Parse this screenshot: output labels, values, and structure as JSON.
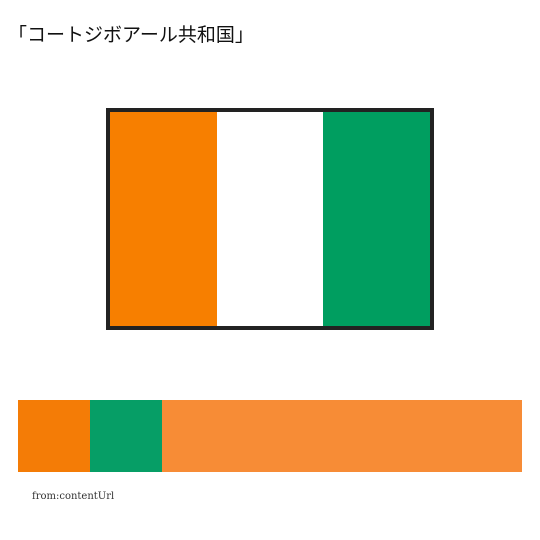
{
  "title": "「コートジボアール共和国」",
  "flag": {
    "stripes": [
      {
        "color": "#f77f00"
      },
      {
        "color": "#ffffff"
      },
      {
        "color": "#009e60"
      }
    ]
  },
  "palette": [
    {
      "color": "#f47c06"
    },
    {
      "color": "#069e66"
    },
    {
      "color": "#f78c36"
    }
  ],
  "source_label": "from:contentUrl"
}
